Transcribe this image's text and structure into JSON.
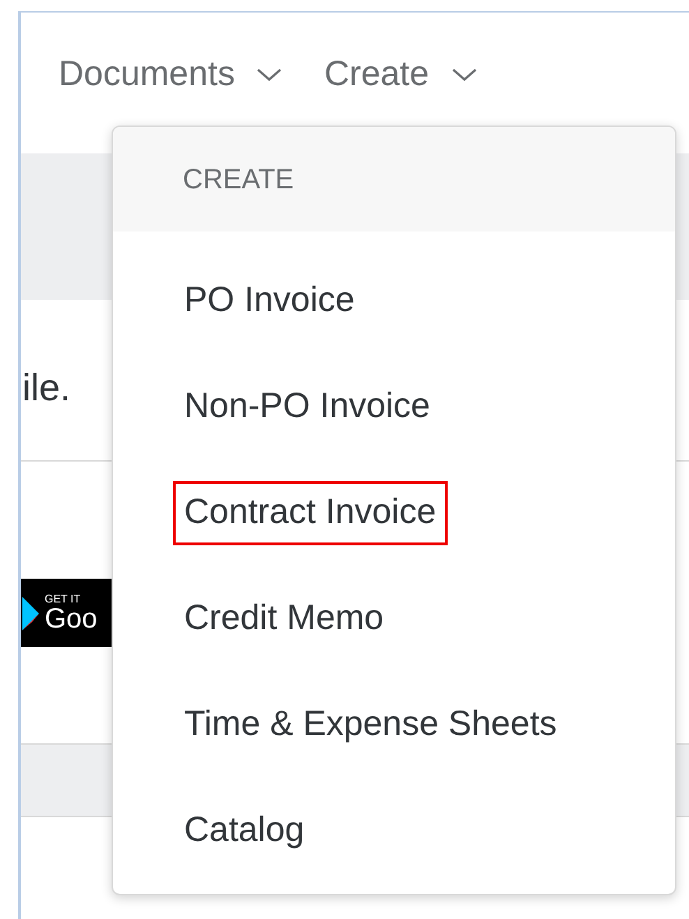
{
  "nav": [
    {
      "label": "Documents"
    },
    {
      "label": "Create"
    }
  ],
  "background": {
    "text": "ile.",
    "badge": {
      "line_1": "GET IT",
      "line_2": "Goo"
    }
  },
  "menu": {
    "header": "CREATE",
    "items": [
      {
        "label": "PO Invoice",
        "highlighted": false
      },
      {
        "label": "Non-PO Invoice",
        "highlighted": false
      },
      {
        "label": "Contract Invoice",
        "highlighted": true
      },
      {
        "label": "Credit Memo",
        "highlighted": false
      },
      {
        "label": "Time & Expense Sheets",
        "highlighted": false
      },
      {
        "label": "Catalog",
        "highlighted": false
      }
    ]
  }
}
